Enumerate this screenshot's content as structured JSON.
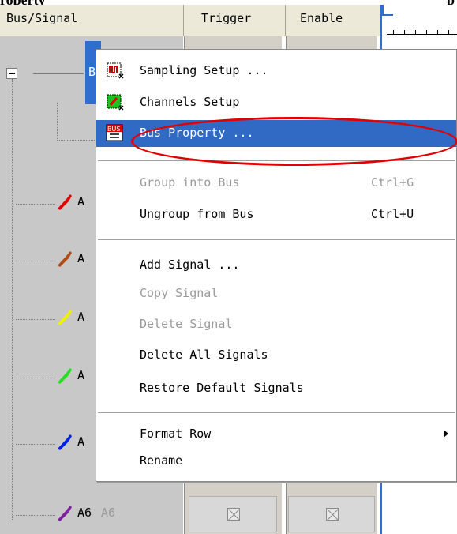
{
  "caption": {
    "left_text": "roperty",
    "right_text": "p"
  },
  "headers": {
    "bus_signal": "Bus/Signal",
    "trigger": "Trigger",
    "enable": "Enable"
  },
  "tree": {
    "bus_label": "B",
    "signals": [
      {
        "label": "A",
        "color": "#e00000"
      },
      {
        "label": "A",
        "color": "#b04a10"
      },
      {
        "label": "A",
        "color": "#f0f000"
      },
      {
        "label": "A",
        "color": "#20e020"
      },
      {
        "label": "A",
        "color": "#0020e0"
      },
      {
        "label": "A6",
        "label2": "A6",
        "color": "#8020a0"
      }
    ]
  },
  "menu": {
    "items": [
      {
        "label": "Sampling Setup ...",
        "icon": "sampling-setup-icon"
      },
      {
        "label": "Channels Setup",
        "icon": "channels-setup-icon"
      },
      {
        "label": "Bus Property ...",
        "icon": "bus-property-icon",
        "selected": true
      },
      {
        "label": "Group into Bus",
        "shortcut": "Ctrl+G",
        "disabled": true
      },
      {
        "label": "Ungroup from Bus",
        "shortcut": "Ctrl+U"
      },
      {
        "label": "Add Signal ..."
      },
      {
        "label": "Copy Signal",
        "disabled": true
      },
      {
        "label": "Delete Signal",
        "disabled": true
      },
      {
        "label": "Delete All Signals"
      },
      {
        "label": "Restore Default Signals"
      },
      {
        "label": "Format Row",
        "submenu": true
      },
      {
        "label": "Rename"
      }
    ]
  },
  "colors": {
    "selection": "#316ac5",
    "accent": "#2f6ecf",
    "highlight_ring": "#e00000"
  }
}
